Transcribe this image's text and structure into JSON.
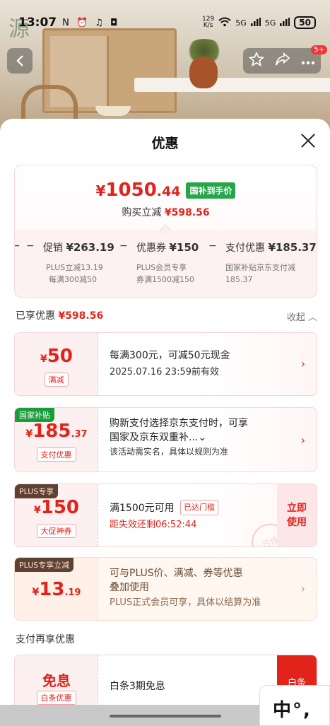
{
  "status_bar": {
    "time": "13:07",
    "left_icons": "N ⏰ ♫ ◘",
    "net_speed_top": "129",
    "net_speed_bottom": "K/s",
    "signal_a": "5G",
    "signal_b": "5G",
    "battery": "50"
  },
  "background": {
    "brand_stamp": "源"
  },
  "nav": {
    "notification_badge": "5+"
  },
  "sheet": {
    "title": "优惠",
    "summary": {
      "price_symbol": "¥",
      "price_int": "1050",
      "price_dec": ".44",
      "price_tag": "国补到手价",
      "subtotal_label": "购买立减",
      "subtotal_value": "¥598.56",
      "breakdown": [
        {
          "label": "促销",
          "value": "¥263.19",
          "sub1": "PLUS立减13.19",
          "sub2": "每满300减50"
        },
        {
          "label": "优惠券",
          "value": "¥150",
          "sub1": "PLUS会员专享",
          "sub2": "券满1500减150"
        },
        {
          "label": "支付优惠",
          "value": "¥185.37",
          "sub1": "国家补贴京东支付减",
          "sub2": "185.37"
        }
      ],
      "minus": "−"
    },
    "enjoyed": {
      "label": "已享优惠",
      "value": "¥598.56",
      "collapse": "收起 ︿"
    },
    "cards": [
      {
        "yen": "¥",
        "amount": "50",
        "dec": "",
        "kind": "满减",
        "line1": "每满300元，可减50元现金",
        "line2": "2025.07.16 23:59前有效",
        "arrow": "›"
      },
      {
        "corner": "国家补贴",
        "yen": "¥",
        "amount": "185",
        "dec": ".37",
        "kind": "支付优惠",
        "line1": "购新支付选择京东支付时，可享",
        "line2": "国家及京东双重补...⌄",
        "line3": "该活动需实名，具体以规则为准",
        "arrow": "›"
      },
      {
        "corner": "PLUS专享",
        "yen": "¥",
        "amount": "150",
        "dec": "",
        "kind": "大促神券",
        "line1": "满1500元可用",
        "reached": "已达门槛",
        "line2": "距失效还剩06:52:44",
        "use_line1": "立即",
        "use_line2": "使用",
        "stamp": "已领"
      },
      {
        "corner": "PLUS专享立减",
        "yen": "¥",
        "amount": "13",
        "dec": ".19",
        "line1": "可与PLUS价、满减、券等优惠",
        "line2": "叠加使用",
        "line3": "PLUS正式会员可享，具体以结算为准",
        "arrow": "›"
      }
    ],
    "pay_section": {
      "title": "支付再享优惠",
      "free_label": "免息",
      "kind": "白条优惠",
      "text": "白条3期免息",
      "button": "白条"
    }
  },
  "ime": {
    "text": "中°,"
  }
}
